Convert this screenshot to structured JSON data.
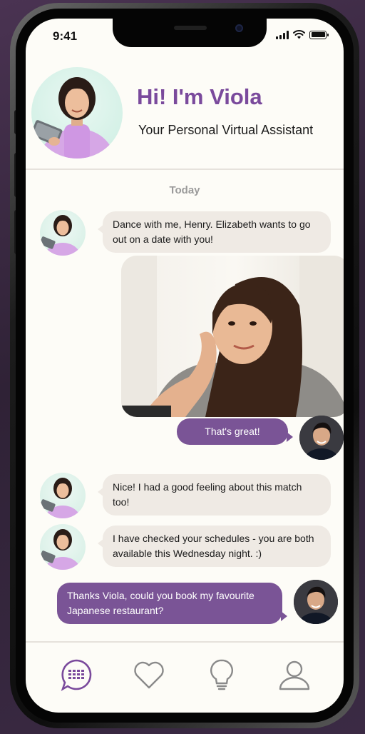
{
  "status_bar": {
    "time": "9:41"
  },
  "assistant": {
    "greeting": "Hi! I'm Viola",
    "tagline": "Your Personal Virtual Assistant"
  },
  "chat": {
    "date_label": "Today",
    "messages": [
      {
        "sender": "assistant",
        "text": "Dance with me, Henry. Elizabeth wants to go out on a date with you!"
      },
      {
        "sender": "assistant",
        "type": "photo"
      },
      {
        "sender": "user",
        "text": "That's great!"
      },
      {
        "sender": "assistant",
        "text": "Nice! I had a good feeling about this match too!"
      },
      {
        "sender": "assistant",
        "text": "I have checked your schedules - you are both available this Wednesday night.  :)"
      },
      {
        "sender": "user",
        "text": "Thanks Viola, could you book my favourite Japanese restaurant?"
      }
    ]
  },
  "tabbar": {
    "tabs": [
      {
        "icon": "chat-bubble-icon",
        "active": true
      },
      {
        "icon": "heart-icon",
        "active": false
      },
      {
        "icon": "lightbulb-icon",
        "active": false
      },
      {
        "icon": "profile-icon",
        "active": false
      }
    ]
  },
  "colors": {
    "accent": "#7a4a9c",
    "outgoing_bubble": "#7a5496",
    "incoming_bubble": "#efeae4",
    "screen_bg": "#fdfcf7"
  }
}
